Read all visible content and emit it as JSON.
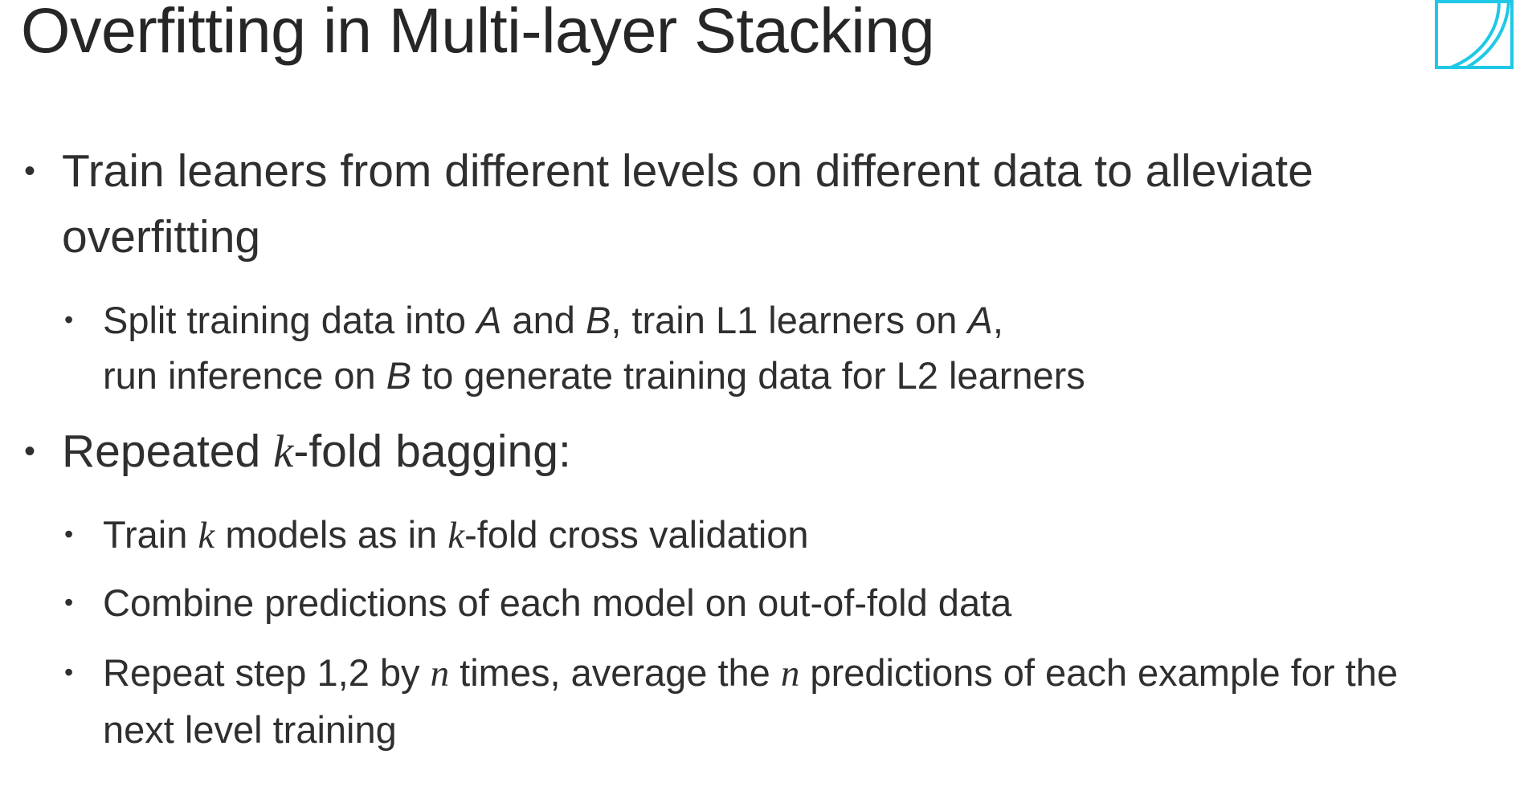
{
  "slide": {
    "title": "Overfitting in Multi-layer Stacking",
    "bullet1": {
      "line1": "Train leaners from different levels on different data to alleviate",
      "line2": "overfitting"
    },
    "sub1": {
      "l1_a": "Split training data into ",
      "var_A": "A",
      "l1_b": " and ",
      "var_B": "B",
      "l1_c": ", train L1 learners on ",
      "var_A2": "A",
      "l1_d": ",",
      "l2_a": "run inference on ",
      "var_B2": "B",
      "l2_b": " to generate training data for L2 learners"
    },
    "bullet2": {
      "a": "Repeated ",
      "var_k": "k",
      "b": "-fold bagging:"
    },
    "sub2": {
      "a": "Train ",
      "var_k": "k",
      "b": " models as in ",
      "var_k2": "k",
      "c": "-fold cross validation"
    },
    "sub3": {
      "text": "Combine predictions of each model on out-of-fold data"
    },
    "sub4": {
      "a": "Repeat step 1,2 by ",
      "var_n": "n",
      "b": " times, average the ",
      "var_n2": "n",
      "c": " predictions of each example for the",
      "line2": "next level training"
    },
    "bullet_char": "•"
  },
  "colors": {
    "logo": "#1ec8e6",
    "text": "#2f2f2f"
  },
  "icons": {
    "logo": "book-logo-icon"
  }
}
